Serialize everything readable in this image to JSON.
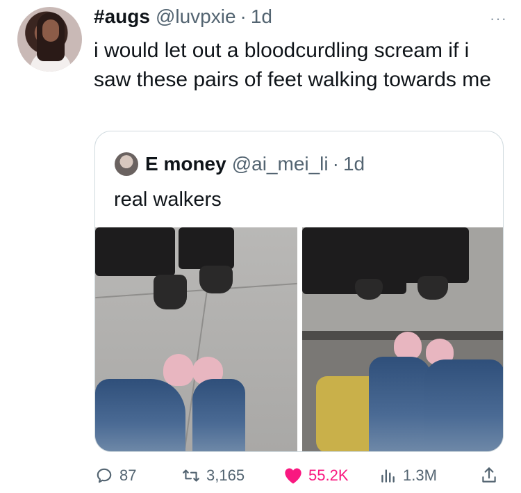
{
  "tweet": {
    "display_name": "#augs",
    "handle": "@luvpxie",
    "separator": "·",
    "time": "1d",
    "more": "···",
    "text": "i would let out a bloodcurdling scream if i saw these pairs of feet walking towards me"
  },
  "quote": {
    "display_name": "E money",
    "handle": "@ai_mei_li",
    "separator": "·",
    "time": "1d",
    "text": "real walkers"
  },
  "actions": {
    "replies": "87",
    "retweets": "3,165",
    "likes": "55.2K",
    "views": "1.3M"
  },
  "colors": {
    "text": "#0f1419",
    "secondary": "#536471",
    "border": "#cfd9de",
    "like": "#f91880"
  },
  "icons": [
    "more-icon",
    "reply-icon",
    "retweet-icon",
    "like-icon",
    "views-icon",
    "share-icon"
  ]
}
